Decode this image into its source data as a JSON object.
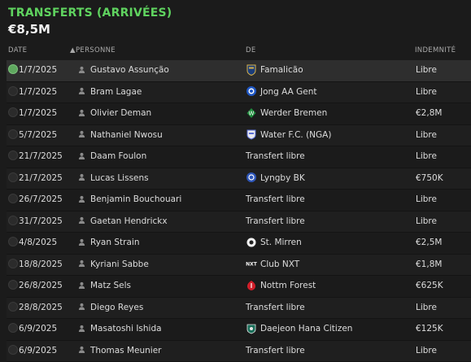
{
  "header": {
    "title": "TRANSFERTS (ARRIVÉES)",
    "total": "€8,5M"
  },
  "columns": {
    "date": "DATE",
    "person": "PERSONNE",
    "from": "DE",
    "fee": "INDEMNITÉ"
  },
  "rows": [
    {
      "date": "1/7/2025",
      "name": "Gustavo Assunção",
      "club": "Famalicão",
      "badge": "famalicao-badge-icon",
      "fee": "Libre",
      "selected": true
    },
    {
      "date": "1/7/2025",
      "name": "Bram Lagae",
      "club": "Jong AA Gent",
      "badge": "gent-badge-icon",
      "fee": "Libre"
    },
    {
      "date": "1/7/2025",
      "name": "Olivier Deman",
      "club": "Werder Bremen",
      "badge": "werder-badge-icon",
      "fee": "€2,8M"
    },
    {
      "date": "5/7/2025",
      "name": "Nathaniel Nwosu",
      "club": "Water F.C. (NGA)",
      "badge": "water-fc-badge-icon",
      "fee": "Libre"
    },
    {
      "date": "21/7/2025",
      "name": "Daam Foulon",
      "club": "Transfert libre",
      "badge": "",
      "fee": "Libre"
    },
    {
      "date": "21/7/2025",
      "name": "Lucas Lissens",
      "club": "Lyngby BK",
      "badge": "lyngby-badge-icon",
      "fee": "€750K"
    },
    {
      "date": "26/7/2025",
      "name": "Benjamin Bouchouari",
      "club": "Transfert libre",
      "badge": "",
      "fee": "Libre"
    },
    {
      "date": "31/7/2025",
      "name": "Gaetan Hendrickx",
      "club": "Transfert libre",
      "badge": "",
      "fee": "Libre"
    },
    {
      "date": "4/8/2025",
      "name": "Ryan Strain",
      "club": "St. Mirren",
      "badge": "st-mirren-badge-icon",
      "fee": "€2,5M"
    },
    {
      "date": "18/8/2025",
      "name": "Kyriani Sabbe",
      "club": "Club NXT",
      "badge": "club-nxt-badge-icon",
      "fee": "€1,8M"
    },
    {
      "date": "26/8/2025",
      "name": "Matz Sels",
      "club": "Nottm Forest",
      "badge": "nottm-forest-badge-icon",
      "fee": "€625K"
    },
    {
      "date": "28/8/2025",
      "name": "Diego Reyes",
      "club": "Transfert libre",
      "badge": "",
      "fee": "Libre"
    },
    {
      "date": "6/9/2025",
      "name": "Masatoshi Ishida",
      "club": "Daejeon Hana Citizen",
      "badge": "daejeon-badge-icon",
      "fee": "€125K"
    },
    {
      "date": "6/9/2025",
      "name": "Thomas Meunier",
      "club": "Transfert libre",
      "badge": "",
      "fee": "Libre"
    }
  ],
  "colors": {
    "accent": "#5fd35f",
    "background": "#1b1b1b"
  }
}
